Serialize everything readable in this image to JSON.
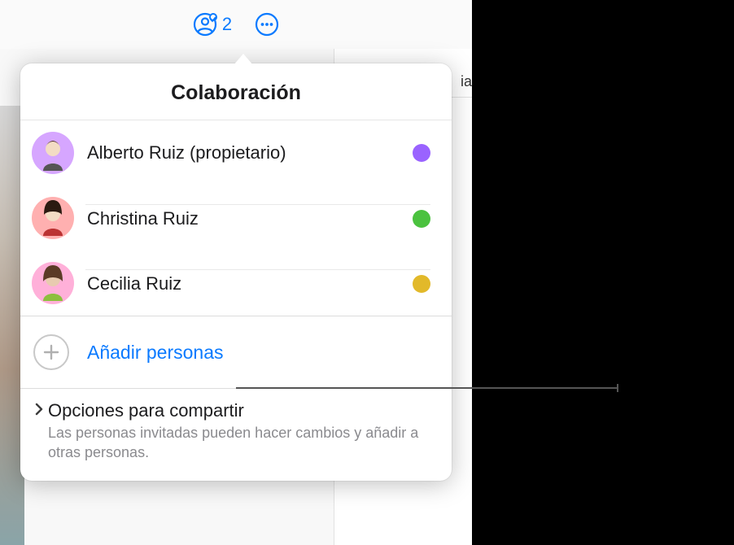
{
  "toolbar": {
    "collaborator_count": "2"
  },
  "popover": {
    "title": "Colaboración",
    "collaborators": [
      {
        "name": "Alberto Ruiz (propietario)",
        "avatar_bg": "#d6a6ff",
        "dot_color": "#9a63ff"
      },
      {
        "name": "Christina Ruiz",
        "avatar_bg": "#ffb0b0",
        "dot_color": "#4bc23f"
      },
      {
        "name": "Cecilia Ruiz",
        "avatar_bg": "#ffb0d9",
        "dot_color": "#e2b92a"
      }
    ],
    "add_label": "Añadir personas",
    "share_options": {
      "title": "Opciones para compartir",
      "subtitle": "Las personas invitadas pueden hacer cambios y añadir a otras personas."
    }
  },
  "background": {
    "right_panel_text_fragment": "ia"
  }
}
